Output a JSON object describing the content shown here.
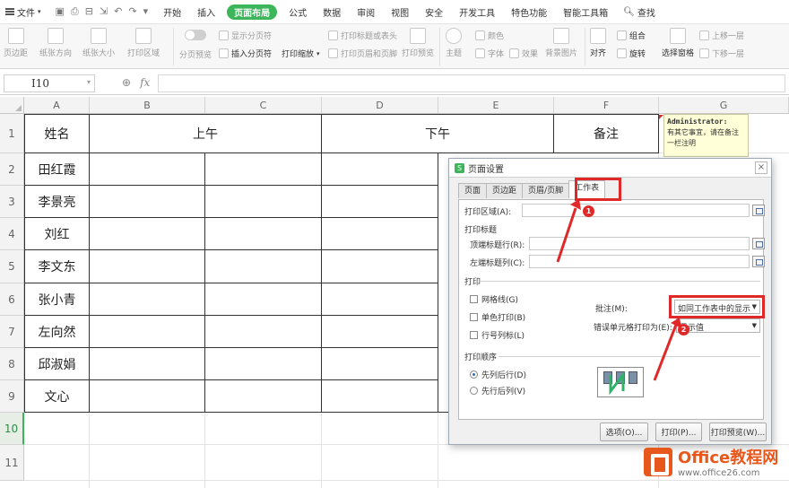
{
  "menubar": {
    "file": "文件",
    "items": [
      "开始",
      "插入",
      "页面布局",
      "公式",
      "数据",
      "审阅",
      "视图",
      "安全",
      "开发工具",
      "特色功能",
      "智能工具箱"
    ],
    "search": "查找"
  },
  "ribbon": {
    "margins": "页边距",
    "orientation": "纸张方向",
    "size": "纸张大小",
    "print_area": "打印区域",
    "page_break_preview": "分页预览",
    "show_page_breaks": "显示分页符",
    "insert_page_break": "插入分页符",
    "print_scale": "打印缩放",
    "print_titles": "打印标题或表头",
    "print_header_footer": "打印页眉和页脚",
    "print_preview": "打印预览",
    "theme": "主题",
    "colors": "颜色",
    "fonts": "字体",
    "effects": "效果",
    "background": "背景图片",
    "align": "对齐",
    "group": "组合",
    "rotate": "旋转",
    "selection_pane": "选择窗格",
    "bring_forward": "上移一层",
    "send_backward": "下移一层"
  },
  "formula_bar": {
    "cell_ref": "I10",
    "fx": "fx"
  },
  "sheet": {
    "columns": [
      "A",
      "B",
      "C",
      "D",
      "E",
      "F",
      "G"
    ],
    "rows": [
      "1",
      "2",
      "3",
      "4",
      "5",
      "6",
      "7",
      "8",
      "9",
      "10",
      "11"
    ],
    "header": {
      "name": "姓名",
      "morning": "上午",
      "afternoon": "下午",
      "note": "备注"
    },
    "names": [
      "田红霞",
      "李景亮",
      "刘红",
      "李文东",
      "张小青",
      "左向然",
      "邱淑娟",
      "文心"
    ],
    "comment": {
      "author": "Administrator:",
      "text": "有其它事宜，请在备注一栏注明"
    }
  },
  "dialog": {
    "title": "页面设置",
    "tabs": [
      "页面",
      "页边距",
      "页眉/页脚",
      "工作表"
    ],
    "print_area_label": "打印区域(A):",
    "print_titles_section": "打印标题",
    "top_rows_label": "顶端标题行(R):",
    "left_cols_label": "左端标题列(C):",
    "print_section": "打印",
    "gridlines": "网格线(G)",
    "mono": "单色打印(B)",
    "row_col_headers": "行号列标(L)",
    "comments_label": "批注(M):",
    "comments_value": "如同工作表中的显示",
    "cell_errors_label": "错误单元格打印为(E):",
    "cell_errors_value": "显示值",
    "page_order_section": "打印顺序",
    "down_then_over": "先列后行(D)",
    "over_then_down": "先行后列(V)",
    "options_btn": "选项(O)...",
    "print_btn": "打印(P)...",
    "preview_btn": "打印预览(W)...",
    "badge1": "1",
    "badge2": "2"
  },
  "watermark": {
    "brand": "Office教程网",
    "url": "www.office26.com"
  },
  "colors": {
    "accent": "#3db55a",
    "highlight": "#e02828",
    "brand": "#e8571c"
  }
}
